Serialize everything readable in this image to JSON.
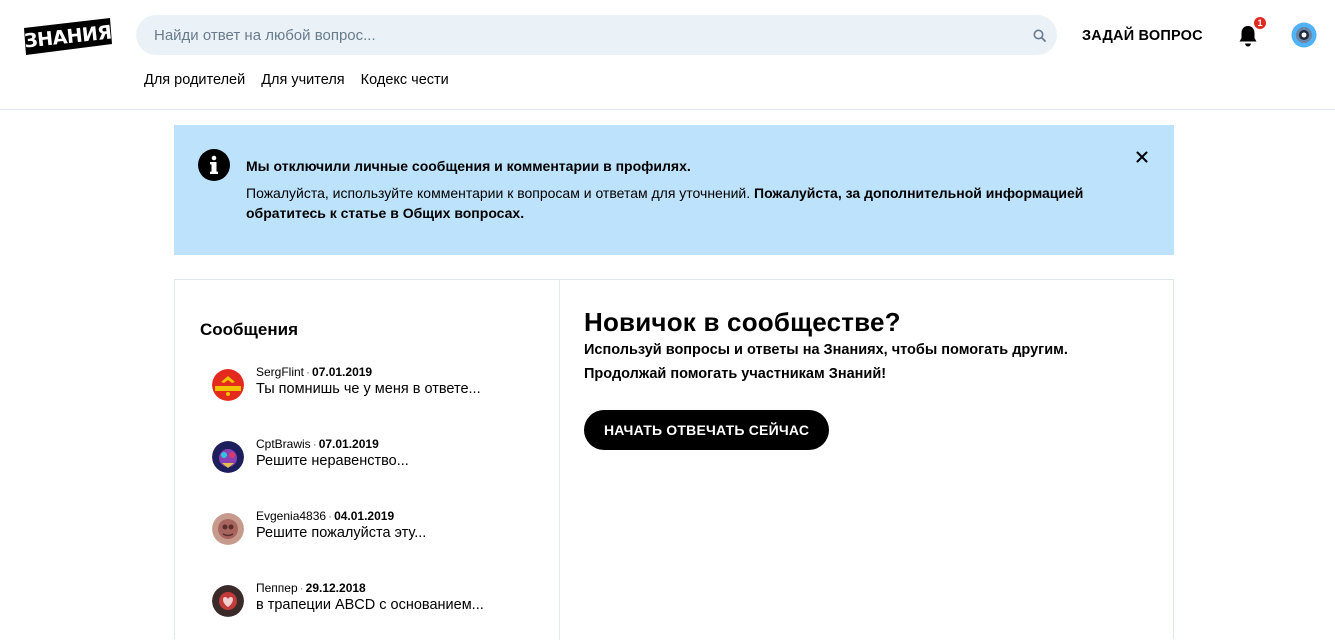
{
  "brand": {
    "logo_text": "ЗНАНИЯ"
  },
  "header": {
    "search_placeholder": "Найди ответ на любой вопрос...",
    "ask_button": "ЗАДАЙ ВОПРОС",
    "notification_count": "1",
    "nav": [
      {
        "label": "Для родителей"
      },
      {
        "label": "Для учителя"
      },
      {
        "label": "Кодекс чести"
      }
    ]
  },
  "banner": {
    "title": "Мы отключили личные сообщения и комментарии в профилях.",
    "text_part1": "Пожалуйста, используйте комментарии к вопросам и ответам для уточнений. ",
    "text_part2_bold": "Пожалуйста, за дополнительной информацией обратитесь к статье в Общих вопросах.",
    "background": "#bde2fb"
  },
  "messages": {
    "title": "Сообщения",
    "items": [
      {
        "author": "SergFlint",
        "date": "07.01.2019",
        "text": "Ты помнишь че у меня в ответе..."
      },
      {
        "author": "CptBrawis",
        "date": "07.01.2019",
        "text": "Решите неравенство..."
      },
      {
        "author": "Evgenia4836",
        "date": "04.01.2019",
        "text": "Решите пожалуйста эту..."
      },
      {
        "author": "Пеппер",
        "date": "29.12.2018",
        "text": "в трапеции ABCD с основанием..."
      }
    ]
  },
  "newbie": {
    "title": "Новичок в сообществе?",
    "line1": "Используй вопросы и ответы на Знаниях, чтобы помогать другим.",
    "line2": "Продолжай помогать участникам Знаний!",
    "button": "НАЧАТЬ ОТВЕЧАТЬ СЕЙЧАС"
  },
  "colors": {
    "notification_badge": "#e02a1f",
    "search_bg": "#ebf2f7",
    "button_bg": "#000000"
  }
}
